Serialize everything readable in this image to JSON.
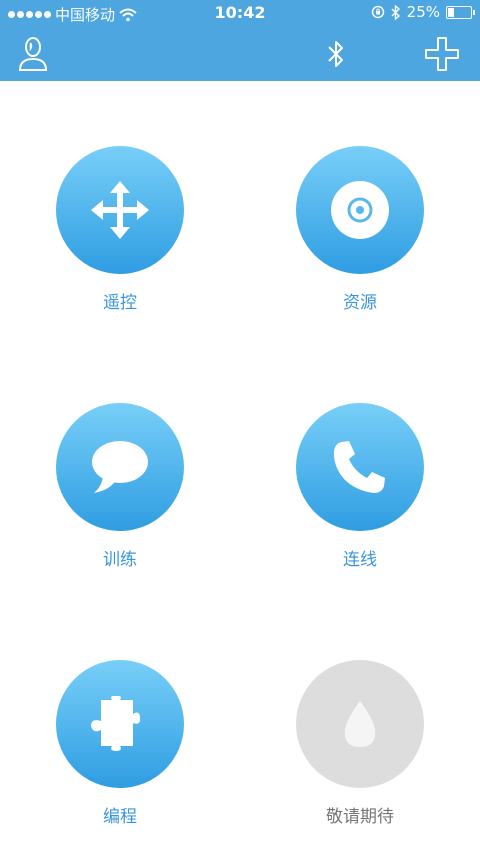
{
  "status_bar": {
    "carrier": "中国移动",
    "time": "10:42",
    "battery_percent": "25%",
    "battery_level": 0.25,
    "icons": [
      "signal-dots-icon",
      "wifi-icon",
      "orientation-lock-icon",
      "bluetooth-icon",
      "battery-icon"
    ]
  },
  "nav_bar": {
    "background_color": "#4da6e0",
    "icons": [
      "user-icon",
      "bluetooth-icon",
      "plus-icon"
    ]
  },
  "tiles": [
    {
      "label": "遥控",
      "icon": "move-arrows-icon",
      "enabled": true
    },
    {
      "label": "资源",
      "icon": "disc-icon",
      "enabled": true
    },
    {
      "label": "训练",
      "icon": "speech-bubble-icon",
      "enabled": true
    },
    {
      "label": "连线",
      "icon": "phone-icon",
      "enabled": true
    },
    {
      "label": "编程",
      "icon": "puzzle-icon",
      "enabled": true
    },
    {
      "label": "敬请期待",
      "icon": "water-drop-icon",
      "enabled": false
    }
  ],
  "colors": {
    "accent": "#3a96dc",
    "circle_gradient_top": "#78cff8",
    "circle_gradient_bottom": "#2f9de2",
    "disabled_circle": "#dddddd",
    "disabled_label": "#777777"
  }
}
